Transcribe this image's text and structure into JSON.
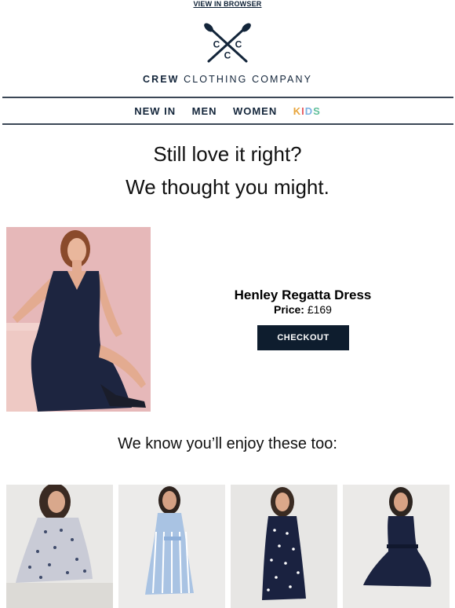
{
  "preheader": {
    "view_in_browser": "VIEW IN BROWSER"
  },
  "brand": {
    "logo_letters": [
      "C",
      "C",
      "C"
    ],
    "name_bold": "CREW",
    "name_rest": " CLOTHING COMPANY",
    "color": "#13253a"
  },
  "nav": {
    "items": [
      "NEW IN",
      "MEN",
      "WOMEN"
    ],
    "kids_letters": [
      "K",
      "I",
      "D",
      "S"
    ],
    "kids_colors": [
      "#e8a53c",
      "#e65c61",
      "#7bb2e2",
      "#5fbf9a"
    ]
  },
  "headline": {
    "line1": "Still love it right?",
    "line2": "We thought you might."
  },
  "product": {
    "name": "Henley Regatta Dress",
    "price_label": "Price:",
    "price_value": " £169",
    "checkout_label": "CHECKOUT",
    "image_icon": "woman-in-navy-dress-photo"
  },
  "recommendations": {
    "heading": "We know you’ll enjoy these too:",
    "items": [
      {
        "image": "floral-print-dress-photo"
      },
      {
        "image": "blue-striped-dress-photo"
      },
      {
        "image": "navy-polka-dot-dress-photo"
      },
      {
        "image": "navy-belted-dress-photo"
      }
    ]
  },
  "colors": {
    "navy": "#0e1d2e",
    "rule": "#3b4756",
    "photo_pink": "#e3b2b3"
  }
}
